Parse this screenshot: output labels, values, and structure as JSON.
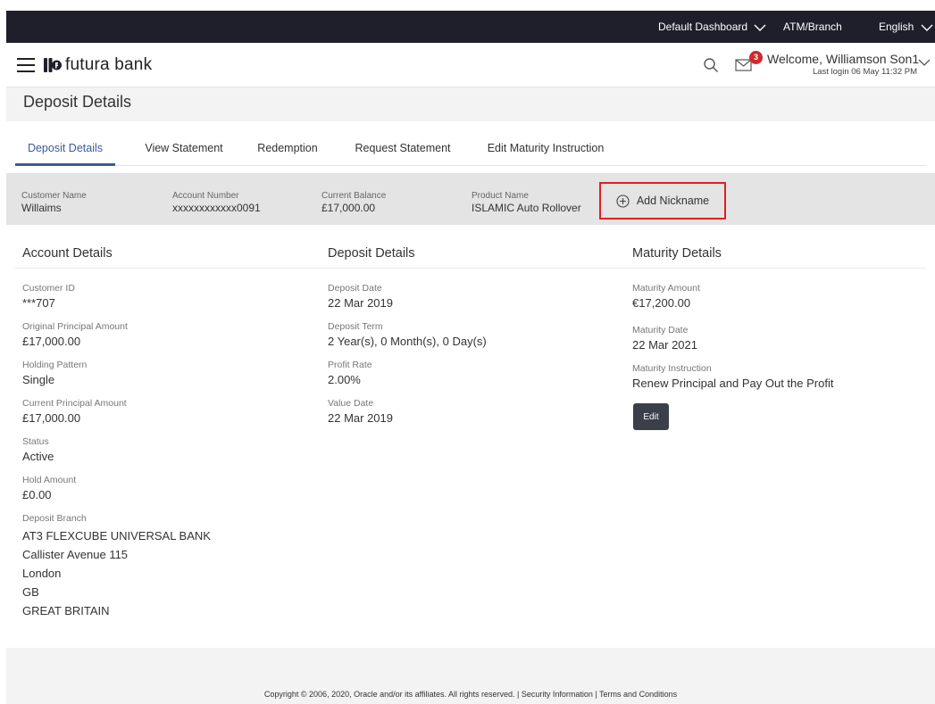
{
  "topbar": {
    "dashboard": "Default Dashboard",
    "atm_branch": "ATM/Branch",
    "language": "English"
  },
  "header": {
    "brand": "futura bank",
    "mail_count": "3",
    "welcome": "Welcome, Williamson Son1",
    "last_login": "Last login 06 May 11:32 PM"
  },
  "page_title": "Deposit Details",
  "tabs": [
    {
      "label": "Deposit Details",
      "active": true
    },
    {
      "label": "View Statement"
    },
    {
      "label": "Redemption"
    },
    {
      "label": "Request Statement"
    },
    {
      "label": "Edit Maturity Instruction"
    }
  ],
  "summary": {
    "customer_name": {
      "label": "Customer Name",
      "value": "Willaims"
    },
    "account_number": {
      "label": "Account Number",
      "value": "xxxxxxxxxxxx0091"
    },
    "current_balance": {
      "label": "Current Balance",
      "value": "£17,000.00"
    },
    "product_name": {
      "label": "Product Name",
      "value": "ISLAMIC Auto Rollover"
    },
    "add_nickname": "Add Nickname"
  },
  "account_details": {
    "heading": "Account Details",
    "customer_id": {
      "label": "Customer ID",
      "value": "***707"
    },
    "original_principal": {
      "label": "Original Principal Amount",
      "value": "£17,000.00"
    },
    "holding_pattern": {
      "label": "Holding Pattern",
      "value": "Single"
    },
    "current_principal": {
      "label": "Current Principal Amount",
      "value": "£17,000.00"
    },
    "status": {
      "label": "Status",
      "value": "Active"
    },
    "hold_amount": {
      "label": "Hold Amount",
      "value": "£0.00"
    },
    "deposit_branch": {
      "label": "Deposit Branch",
      "lines": [
        "AT3 FLEXCUBE UNIVERSAL BANK",
        "Callister Avenue 115",
        "London",
        "GB",
        "GREAT BRITAIN"
      ]
    }
  },
  "deposit_details": {
    "heading": "Deposit Details",
    "deposit_date": {
      "label": "Deposit Date",
      "value": "22 Mar 2019"
    },
    "deposit_term": {
      "label": "Deposit Term",
      "value": "2 Year(s), 0 Month(s), 0 Day(s)"
    },
    "profit_rate": {
      "label": "Profit Rate",
      "value": "2.00%"
    },
    "value_date": {
      "label": "Value Date",
      "value": "22 Mar 2019"
    }
  },
  "maturity_details": {
    "heading": "Maturity Details",
    "maturity_amount": {
      "label": "Maturity Amount",
      "value": "€17,200.00"
    },
    "maturity_date": {
      "label": "Maturity Date",
      "value": "22 Mar 2021"
    },
    "maturity_instruction": {
      "label": "Maturity Instruction",
      "value": "Renew Principal and Pay Out the Profit"
    },
    "edit_button": "Edit"
  },
  "footer": "Copyright © 2006, 2020, Oracle and/or its affiliates. All rights reserved. | Security Information | Terms and Conditions",
  "colors": {
    "topbar": "#1f1f2b",
    "active_tab": "#3c5a99",
    "highlight_border": "#e02020",
    "badge": "#d3262d",
    "edit_button": "#3a3f4a"
  }
}
